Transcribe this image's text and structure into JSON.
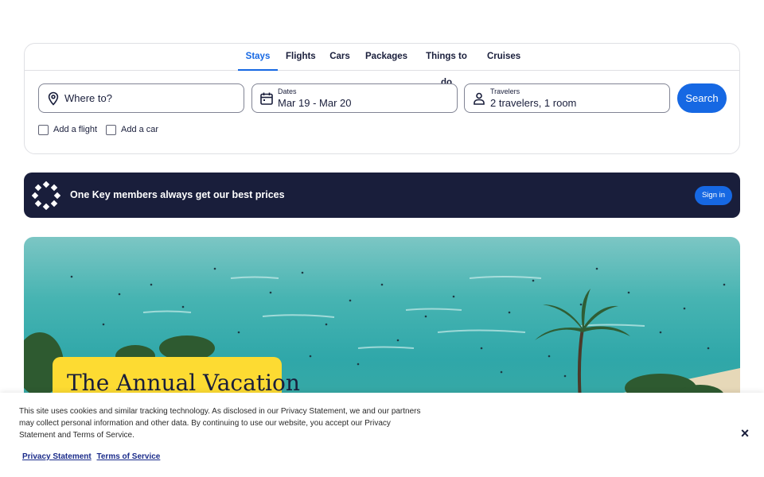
{
  "tabs": [
    {
      "label": "Stays",
      "active": true
    },
    {
      "label": "Flights",
      "active": false
    },
    {
      "label": "Cars",
      "active": false
    },
    {
      "label": "Packages",
      "active": false
    },
    {
      "label": "Things to do",
      "active": false
    },
    {
      "label": "Cruises",
      "active": false
    }
  ],
  "search": {
    "destination_placeholder": "Where to?",
    "dates_label": "Dates",
    "dates_value": "Mar 19 - Mar 20",
    "travelers_label": "Travelers",
    "travelers_value": "2 travelers, 1 room",
    "search_button": "Search",
    "add_flight": "Add a flight",
    "add_car": "Add a car"
  },
  "banner": {
    "message": "One Key members always get our best prices",
    "sign_in": "Sign in"
  },
  "hero": {
    "title": "The Annual Vacation"
  },
  "cookie": {
    "message": "This site uses cookies and similar tracking technology. As disclosed in our Privacy Statement, we and our partners may collect personal information and other data. By continuing to use our website, you accept our Privacy Statement and Terms of Service.",
    "privacy_link": "Privacy Statement",
    "terms_link": "Terms of Service",
    "close": "×"
  },
  "colors": {
    "brand_blue": "#1668e3",
    "navy": "#191e3b",
    "badge_yellow": "#fddb32"
  }
}
